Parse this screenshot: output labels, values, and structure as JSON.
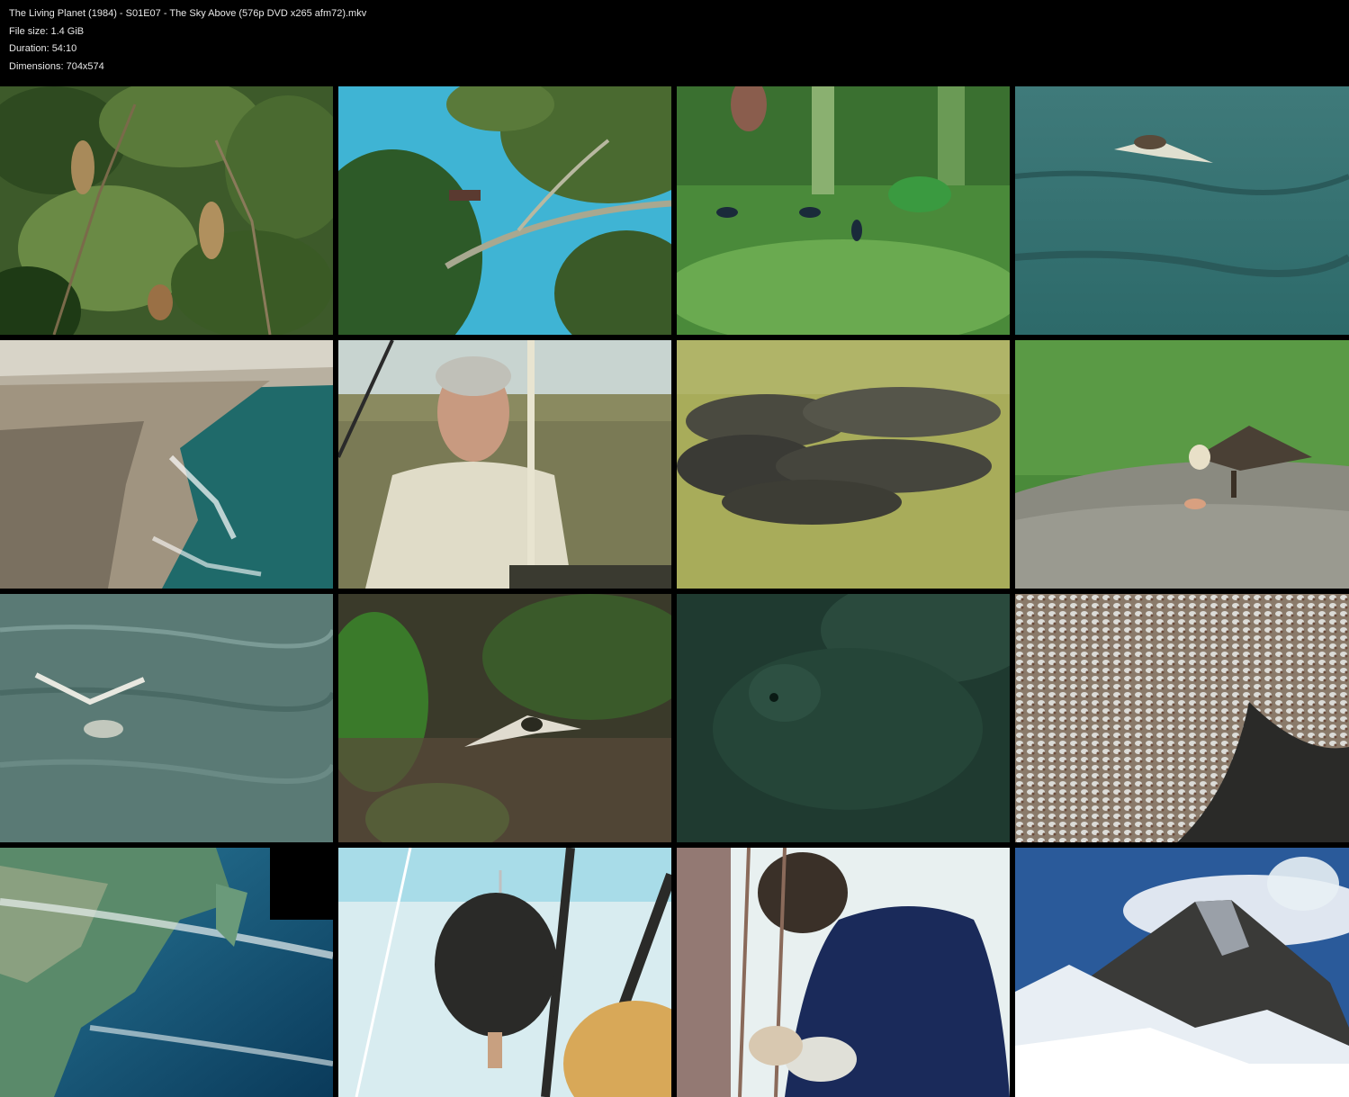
{
  "header": {
    "filename": "The Living Planet (1984) - S01E07 - The Sky Above (576p DVD x265 afm72).mkv",
    "file_size": "File size: 1.4 GiB",
    "duration": "Duration: 54:10",
    "dimensions": "Dimensions: 704x574"
  },
  "thumbnails": [
    {
      "scene": "jungle-seed-pods"
    },
    {
      "scene": "tree-canopy-sky"
    },
    {
      "scene": "damselflies-leaves"
    },
    {
      "scene": "seabird-over-ocean"
    },
    {
      "scene": "coastal-cliffs"
    },
    {
      "scene": "presenter-in-balloon"
    },
    {
      "scene": "wildebeest-herd"
    },
    {
      "scene": "vulture-on-rock"
    },
    {
      "scene": "tern-diving-sea"
    },
    {
      "scene": "bird-in-forest"
    },
    {
      "scene": "dark-green-animal"
    },
    {
      "scene": "shorebird-flock"
    },
    {
      "scene": "earth-from-space"
    },
    {
      "scene": "balloon-burner"
    },
    {
      "scene": "balloonist-climber"
    },
    {
      "scene": "mount-everest"
    }
  ]
}
